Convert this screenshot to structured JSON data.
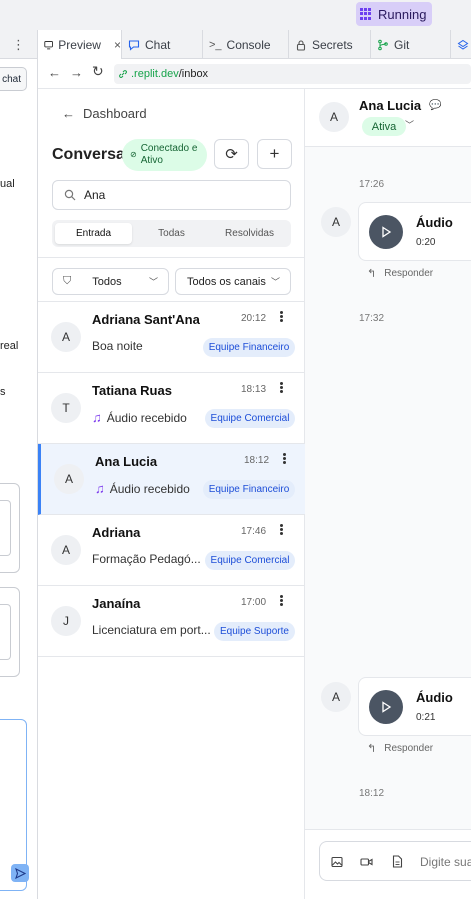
{
  "topbar": {
    "run_status": "Running"
  },
  "tabs": [
    {
      "label": "Preview",
      "icon": "monitor-icon",
      "closable": true
    },
    {
      "label": "Chat",
      "icon": "chat-bubble-icon"
    },
    {
      "label": "Console",
      "icon": "terminal-icon"
    },
    {
      "label": "Secrets",
      "icon": "lock-icon"
    },
    {
      "label": "Git",
      "icon": "git-branch-icon"
    }
  ],
  "left_strip": {
    "chat_button": "chat",
    "texts": [
      "ual",
      "real",
      "s"
    ]
  },
  "browser": {
    "url_domain": ".replit.dev",
    "url_path": "/inbox"
  },
  "inbox": {
    "back_label": "Dashboard",
    "title": "Conversas",
    "status_line1": "Conectado e",
    "status_line2": "Ativo",
    "search_value": "Ana",
    "segments": [
      "Entrada",
      "Todas",
      "Resolvidas"
    ],
    "filter_status": "Todos",
    "filter_channel": "Todos os canais",
    "conversations": [
      {
        "initial": "A",
        "name": "Adriana Sant'Ana",
        "time": "20:12",
        "preview": "Boa noite",
        "audio": false,
        "team": "Equipe Financeiro"
      },
      {
        "initial": "T",
        "name": "Tatiana Ruas",
        "time": "18:13",
        "preview": "Áudio recebido",
        "audio": true,
        "team": "Equipe Comercial"
      },
      {
        "initial": "A",
        "name": "Ana Lucia",
        "time": "18:12",
        "preview": "Áudio recebido",
        "audio": true,
        "team": "Equipe Financeiro",
        "selected": true
      },
      {
        "initial": "A",
        "name": "Adriana",
        "time": "17:46",
        "preview": "Formação Pedagó...",
        "audio": false,
        "team": "Equipe Comercial"
      },
      {
        "initial": "J",
        "name": "Janaína",
        "time": "17:00",
        "preview": "Licenciatura em port...",
        "audio": false,
        "team": "Equipe Suporte"
      }
    ]
  },
  "chat": {
    "contact_initial": "A",
    "contact_name": "Ana Lucia",
    "contact_status": "Ativa",
    "timestamps": [
      "17:26",
      "17:32",
      "18:12"
    ],
    "messages": [
      {
        "initial": "A",
        "title": "Áudio",
        "duration": "0:20",
        "reply_label": "Responder"
      },
      {
        "initial": "A",
        "title": "Áudio",
        "duration": "0:21",
        "reply_label": "Responder"
      }
    ],
    "composer_placeholder": "Digite sua"
  },
  "colors": {
    "accent": "#3b82f6",
    "running_bg": "#d8cef8",
    "status_green": "#dcfce7",
    "team_tag_bg": "#e4edfb"
  }
}
